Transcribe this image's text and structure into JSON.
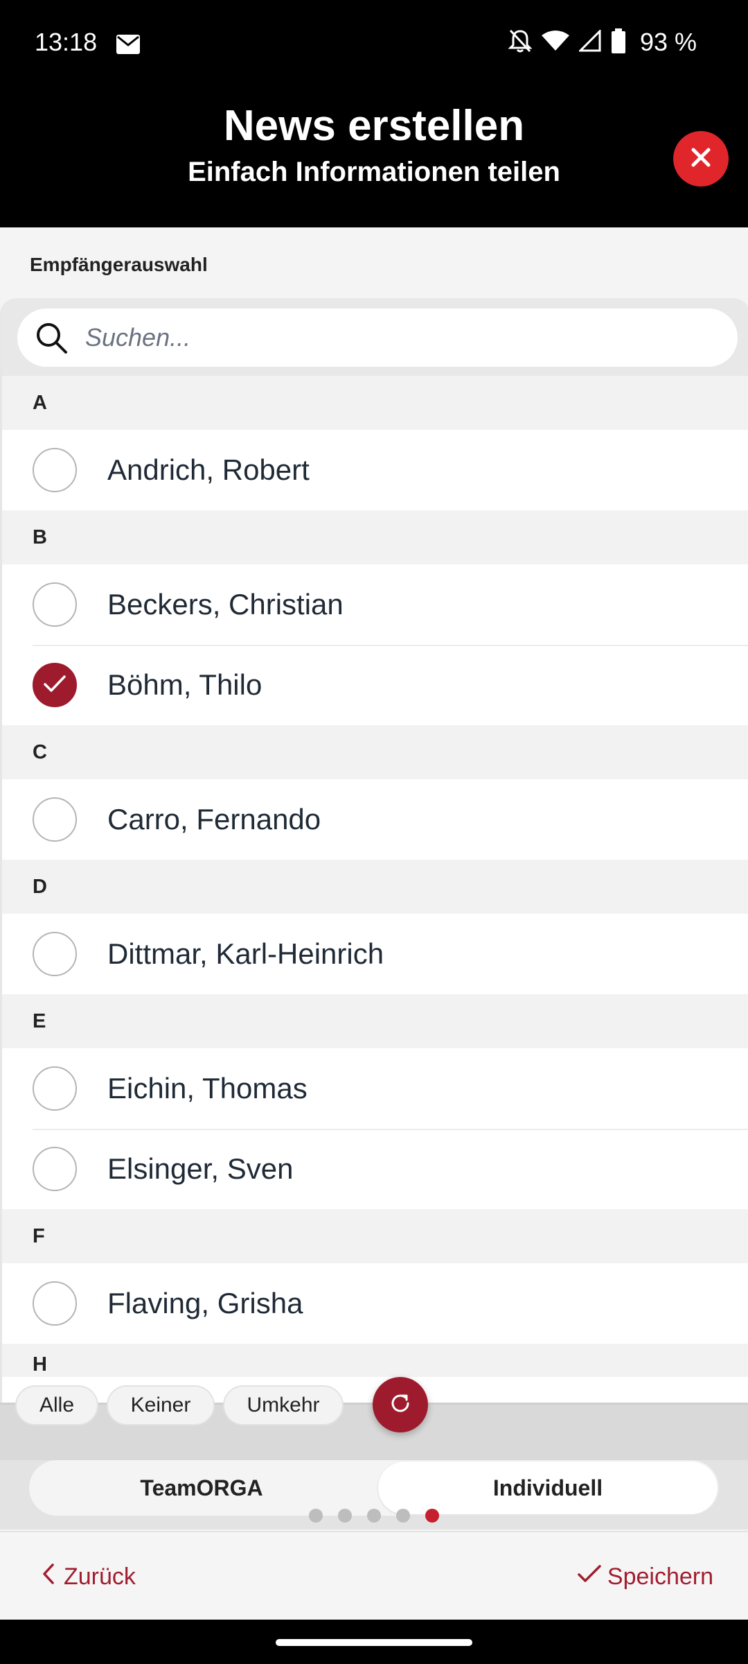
{
  "status_bar": {
    "time": "13:18",
    "battery": "93 %",
    "icons": [
      "mail-icon",
      "bell-off-icon",
      "wifi-icon",
      "signal-icon",
      "battery-icon"
    ]
  },
  "header": {
    "title": "News erstellen",
    "subtitle": "Einfach Informationen teilen",
    "close_icon": "close-icon"
  },
  "recipients": {
    "section_label": "Empfängerauswahl",
    "search_placeholder": "Suchen...",
    "groups": [
      {
        "letter": "A",
        "people": [
          {
            "name": "Andrich, Robert",
            "selected": false
          }
        ]
      },
      {
        "letter": "B",
        "people": [
          {
            "name": "Beckers, Christian",
            "selected": false
          },
          {
            "name": "Böhm, Thilo",
            "selected": true
          }
        ]
      },
      {
        "letter": "C",
        "people": [
          {
            "name": "Carro, Fernando",
            "selected": false
          }
        ]
      },
      {
        "letter": "D",
        "people": [
          {
            "name": "Dittmar, Karl-Heinrich",
            "selected": false
          }
        ]
      },
      {
        "letter": "E",
        "people": [
          {
            "name": "Eichin, Thomas",
            "selected": false
          },
          {
            "name": "Elsinger, Sven",
            "selected": false
          }
        ]
      },
      {
        "letter": "F",
        "people": [
          {
            "name": "Flaving, Grisha",
            "selected": false
          }
        ]
      },
      {
        "letter": "H",
        "people": []
      }
    ]
  },
  "quick_select": {
    "all": "Alle",
    "none": "Keiner",
    "invert": "Umkehr"
  },
  "mode": {
    "options": [
      "TeamORGA",
      "Individuell"
    ],
    "selected": "Individuell"
  },
  "pager": {
    "count": 5,
    "active_index": 4
  },
  "footer": {
    "back": "Zurück",
    "save": "Speichern"
  },
  "colors": {
    "accent": "#9d1b2d",
    "close": "#e0262b",
    "pager_active": "#c6202e"
  }
}
